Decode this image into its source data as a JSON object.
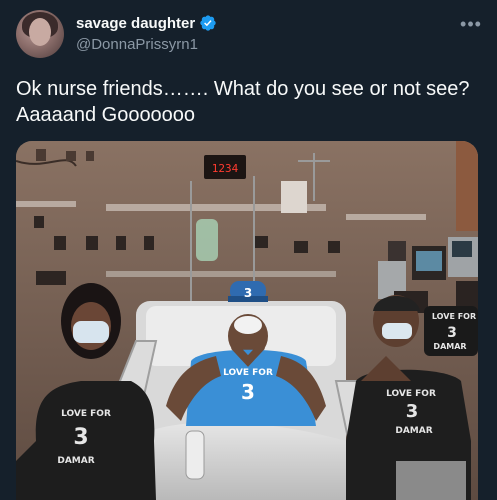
{
  "author": {
    "display_name": "savage daughter",
    "handle": "@DonnaPrissyrn1",
    "verified": true,
    "avatar_icon": "profile-photo"
  },
  "tweet": {
    "text": "Ok nurse friends……. What do you see or not see?  Aaaaand Gooooooo"
  },
  "media": {
    "type": "photo",
    "monitor_readout": "1234",
    "shirt_text_line1": "LOVE FOR",
    "shirt_number": "3",
    "shirt_text_line2": "DAMAR",
    "cap_number": "3"
  },
  "icons": {
    "verified_badge": "verified-check-icon",
    "more": "more-options-icon"
  },
  "colors": {
    "background": "#15202b",
    "text_primary": "#f7f9f9",
    "text_secondary": "#8b98a5",
    "verified": "#1d9bf0",
    "bills_blue": "#3a8fd6"
  }
}
